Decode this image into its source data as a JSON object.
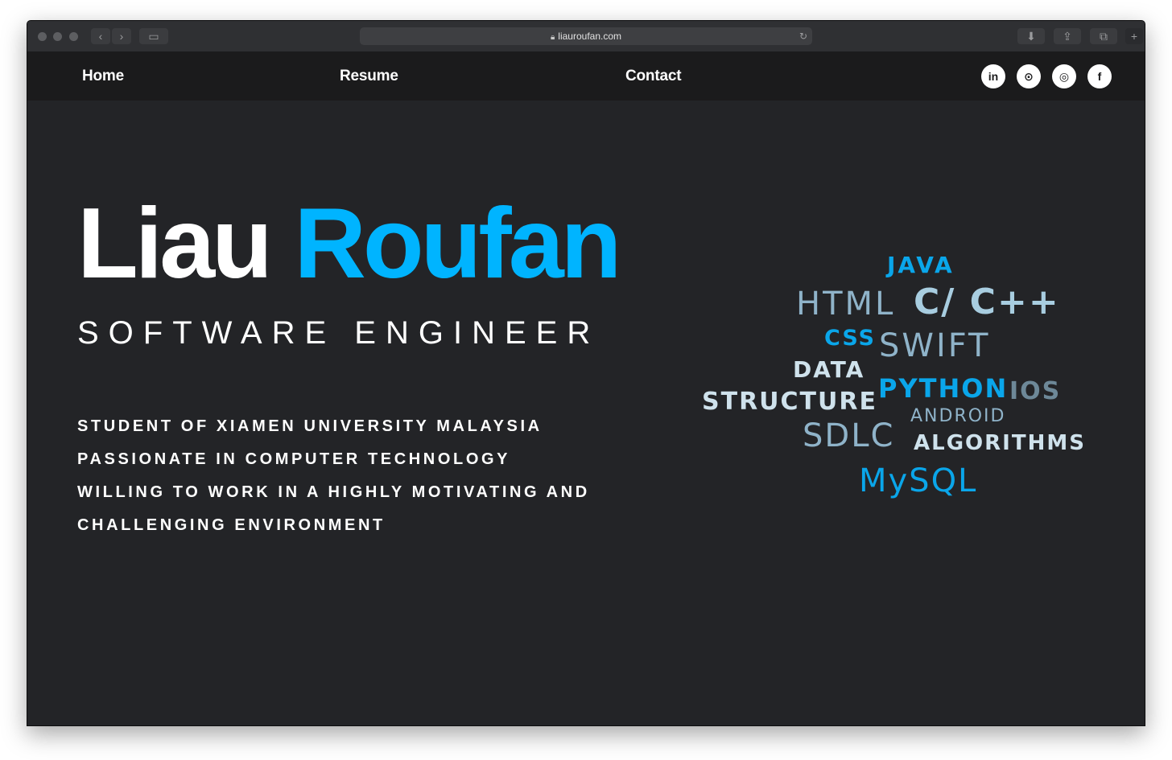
{
  "browser": {
    "url": "liauroufan.com"
  },
  "nav": {
    "links": [
      "Home",
      "Resume",
      "Contact"
    ],
    "social": [
      "linkedin-icon",
      "github-icon",
      "instagram-icon",
      "facebook-icon"
    ],
    "social_glyphs": [
      "in",
      "⊙",
      "◎",
      "f"
    ]
  },
  "hero": {
    "first_name": "Liau",
    "last_name": "Roufan",
    "role": "SOFTWARE ENGINEER",
    "accent_color": "#00b4ff"
  },
  "bio": {
    "lines": [
      "STUDENT OF XIAMEN UNIVERSITY MALAYSIA",
      "PASSIONATE IN COMPUTER TECHNOLOGY",
      "WILLING TO WORK IN A HIGHLY MOTIVATING AND",
      "CHALLENGING ENVIRONMENT"
    ]
  },
  "word_cloud": {
    "words": [
      "JAVA",
      "HTML",
      "C/ C++",
      "CSS",
      "SWIFT",
      "DATA",
      "STRUCTURE",
      "PYTHON",
      "IOS",
      "ANDROID",
      "SDLC",
      "ALGORITHMS",
      "MySQL"
    ]
  }
}
